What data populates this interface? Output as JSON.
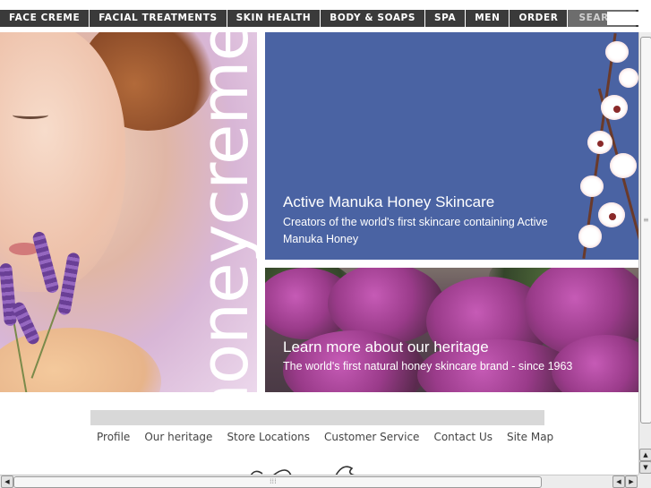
{
  "nav": {
    "items": [
      "FACE CREME",
      "FACIAL TREATMENTS",
      "SKIN HEALTH",
      "BODY & SOAPS",
      "SPA",
      "MEN",
      "ORDER"
    ],
    "search_label": "SEARCH"
  },
  "hero": {
    "brand_word": "honeycreme"
  },
  "promo_main": {
    "title": "Active Manuka Honey Skincare",
    "subtitle": "Creators of the world's first skincare containing Active Manuka Honey"
  },
  "promo_heritage": {
    "title": "Learn more about our heritage",
    "subtitle": "The world's first natural honey skincare brand - since 1963"
  },
  "footer": {
    "links": [
      "Profile",
      "Our heritage",
      "Store Locations",
      "Customer Service",
      "Contact Us",
      "Site Map"
    ]
  },
  "colors": {
    "nav_bg": "#3a3a3a",
    "promo_blue": "#4a63a3",
    "footer_bar": "#d8d8d8"
  }
}
